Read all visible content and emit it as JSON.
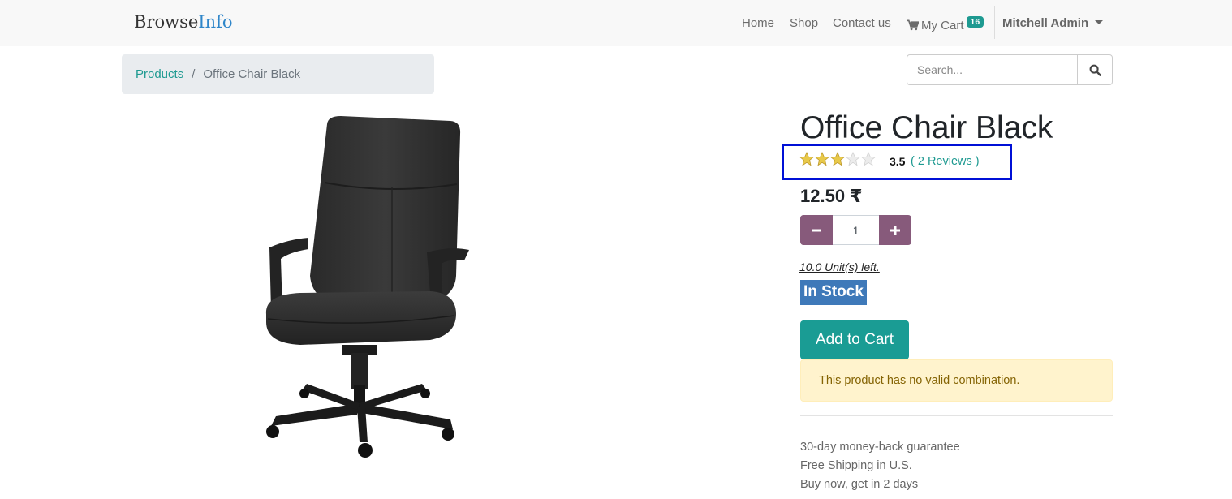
{
  "brand": {
    "part1": "Browse",
    "part2": "Info"
  },
  "nav": {
    "home": "Home",
    "shop": "Shop",
    "contact": "Contact us",
    "cart_label": "My Cart",
    "cart_count": "16",
    "user": "Mitchell Admin"
  },
  "breadcrumb": {
    "parent": "Products",
    "separator": "/",
    "current": "Office Chair Black"
  },
  "search": {
    "placeholder": "Search..."
  },
  "product": {
    "title": "Office Chair Black",
    "rating_value": "3.5",
    "rating_stars": 3,
    "rating_max": 5,
    "reviews": "( 2 Reviews )",
    "price": "12.50 ₹",
    "quantity": "1",
    "units_left": "10.0 Unit(s) left.",
    "stock_status": "In Stock",
    "add_to_cart": "Add to Cart",
    "alert": "This product has no valid combination.",
    "guarantees": [
      "30-day money-back guarantee",
      "Free Shipping in U.S.",
      "Buy now, get in 2 days"
    ]
  },
  "colors": {
    "accent": "#1e9a91",
    "qty_button": "#875a7b",
    "stock_badge": "#3e79b9",
    "highlight_box": "#0010d6",
    "alert_bg": "#fff3cd",
    "star_filled": "#e8c94a",
    "star_empty": "#e6e6e6"
  }
}
